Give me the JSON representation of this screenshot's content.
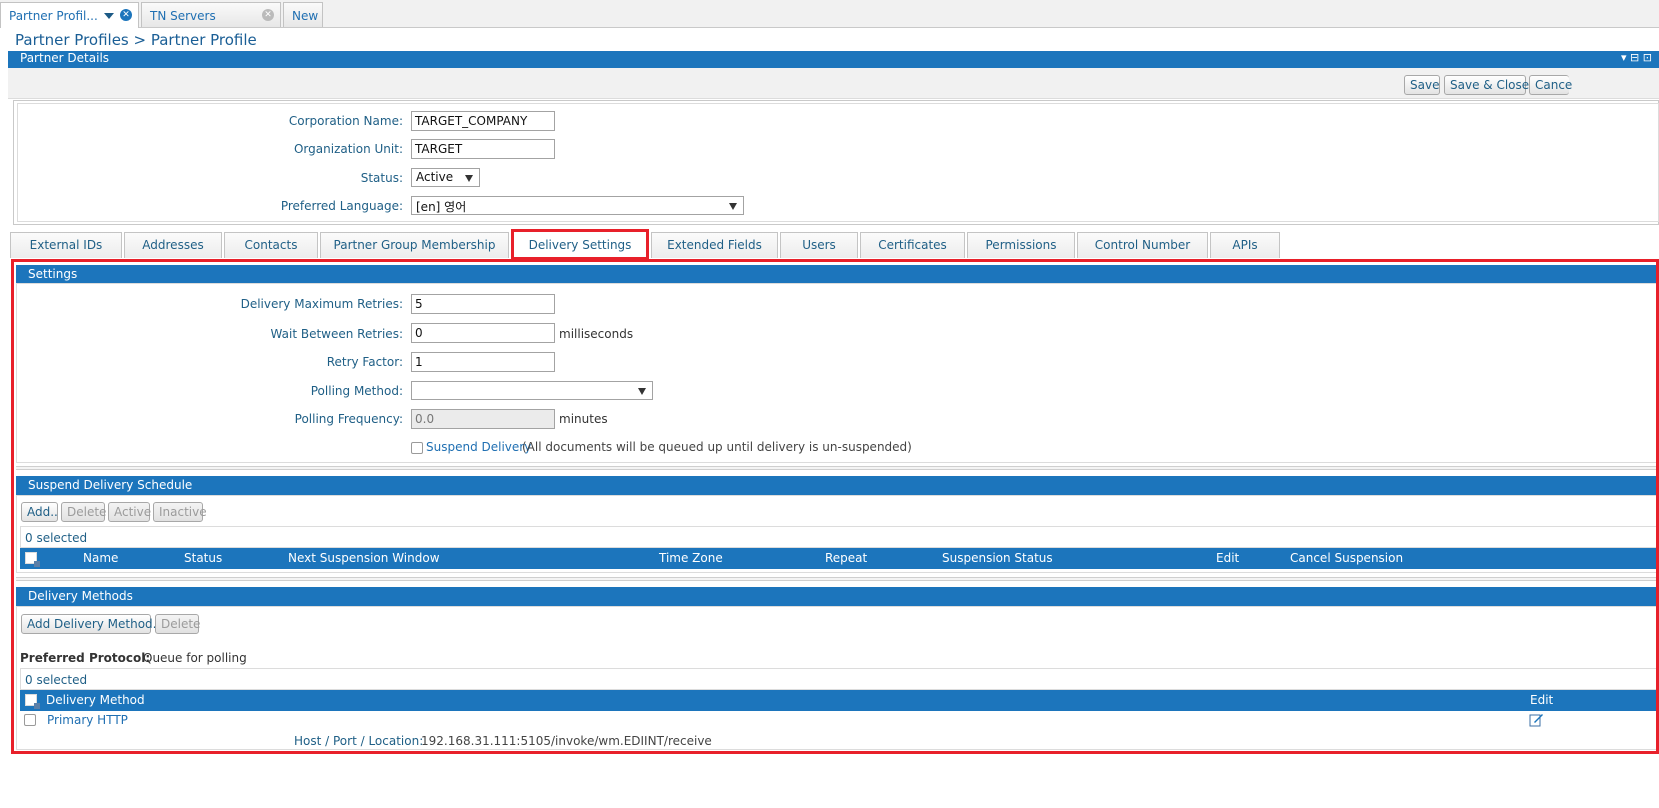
{
  "app_tabs": [
    {
      "label": "Partner Profil..."
    },
    {
      "label": "TN Servers"
    },
    {
      "label": "New"
    }
  ],
  "breadcrumb": "Partner Profiles > Partner Profile",
  "partner_details": {
    "title": "Partner Details",
    "buttons": {
      "save": "Save",
      "save_close": "Save & Close",
      "cancel": "Cance"
    },
    "fields": {
      "corporation_name_label": "Corporation Name:",
      "corporation_name": "TARGET_COMPANY",
      "org_unit_label": "Organization Unit:",
      "org_unit": "TARGET",
      "status_label": "Status:",
      "status": "Active",
      "language_label": "Preferred Language:",
      "language": "[en] 영어"
    }
  },
  "profile_tabs": [
    "External IDs",
    "Addresses",
    "Contacts",
    "Partner Group Membership",
    "Delivery Settings",
    "Extended Fields",
    "Users",
    "Certificates",
    "Permissions",
    "Control Number",
    "APIs"
  ],
  "settings": {
    "title": "Settings",
    "max_retries_label": "Delivery Maximum Retries:",
    "max_retries": "5",
    "wait_label": "Wait Between Retries:",
    "wait": "0",
    "wait_unit": "milliseconds",
    "retry_factor_label": "Retry Factor:",
    "retry_factor": "1",
    "polling_method_label": "Polling Method:",
    "polling_method": "",
    "polling_freq_label": "Polling Frequency:",
    "polling_freq": "0.0",
    "polling_freq_unit": "minutes",
    "suspend_label": "Suspend Delivery",
    "suspend_note": "(All documents will be queued up until delivery is un-suspended)"
  },
  "suspend_schedule": {
    "title": "Suspend Delivery Schedule",
    "buttons": {
      "add": "Add..",
      "delete": "Delete",
      "active": "Active",
      "inactive": "Inactive"
    },
    "selected": "0 selected",
    "columns": [
      "Name",
      "Status",
      "Next Suspension Window",
      "Time Zone",
      "Repeat",
      "Suspension Status",
      "Edit",
      "Cancel Suspension"
    ]
  },
  "delivery_methods": {
    "title": "Delivery Methods",
    "buttons": {
      "add": "Add Delivery Method...",
      "delete": "Delete"
    },
    "preferred_label": "Preferred Protocol:",
    "preferred_value": "Queue for polling",
    "selected": "0 selected",
    "columns": {
      "method": "Delivery Method",
      "edit": "Edit"
    },
    "rows": [
      {
        "name": "Primary HTTP",
        "host_label": "Host / Port / Location:",
        "host_value": "192.168.31.111:5105/invoke/wm.EDIINT/receive"
      }
    ]
  }
}
